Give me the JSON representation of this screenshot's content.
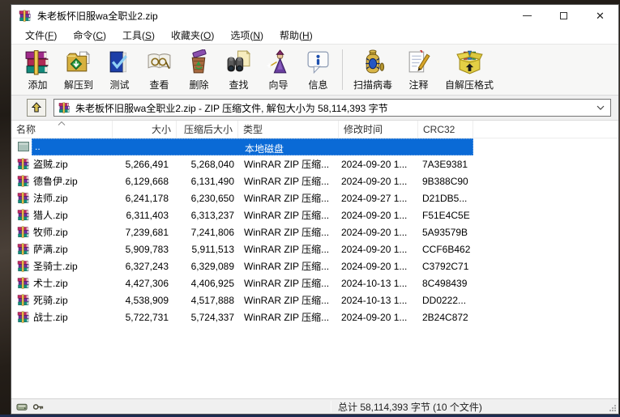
{
  "window": {
    "title": "朱老板怀旧服wa全职业2.zip",
    "controls": {
      "close_glyph": "✕"
    }
  },
  "menu": {
    "items": [
      {
        "pre": "文件(",
        "key": "F",
        "post": ")"
      },
      {
        "pre": "命令(",
        "key": "C",
        "post": ")"
      },
      {
        "pre": "工具(",
        "key": "S",
        "post": ")"
      },
      {
        "pre": "收藏夹(",
        "key": "O",
        "post": ")"
      },
      {
        "pre": "选项(",
        "key": "N",
        "post": ")"
      },
      {
        "pre": "帮助(",
        "key": "H",
        "post": ")"
      }
    ]
  },
  "toolbar": {
    "buttons": [
      {
        "label": "添加",
        "icon": "add-archive-icon"
      },
      {
        "label": "解压到",
        "icon": "extract-to-icon"
      },
      {
        "label": "测试",
        "icon": "test-archive-icon"
      },
      {
        "label": "查看",
        "icon": "view-file-icon"
      },
      {
        "label": "删除",
        "icon": "delete-icon"
      },
      {
        "label": "查找",
        "icon": "find-icon"
      },
      {
        "label": "向导",
        "icon": "wizard-icon"
      },
      {
        "label": "信息",
        "icon": "info-icon"
      },
      {
        "label": "扫描病毒",
        "icon": "scan-virus-icon"
      },
      {
        "label": "注释",
        "icon": "comment-icon"
      },
      {
        "label": "自解压格式",
        "icon": "sfx-icon"
      }
    ]
  },
  "address_bar": {
    "value": "朱老板怀旧服wa全职业2.zip - ZIP 压缩文件, 解包大小为 58,114,393 字节"
  },
  "file_list": {
    "columns": [
      {
        "label": "名称"
      },
      {
        "label": "大小"
      },
      {
        "label": "压缩后大小"
      },
      {
        "label": "类型"
      },
      {
        "label": "修改时间"
      },
      {
        "label": "CRC32"
      }
    ],
    "parent_row": {
      "name": "..",
      "type": "本地磁盘"
    },
    "file_icon": "zip-archive-icon",
    "rows": [
      {
        "name": "盗贼.zip",
        "size": "5,266,491",
        "packed": "5,268,040",
        "type": "WinRAR ZIP 压缩...",
        "modified": "2024-09-20 1...",
        "crc": "7A3E9381"
      },
      {
        "name": "德鲁伊.zip",
        "size": "6,129,668",
        "packed": "6,131,490",
        "type": "WinRAR ZIP 压缩...",
        "modified": "2024-09-20 1...",
        "crc": "9B388C90"
      },
      {
        "name": "法师.zip",
        "size": "6,241,178",
        "packed": "6,230,650",
        "type": "WinRAR ZIP 压缩...",
        "modified": "2024-09-27 1...",
        "crc": "D21DB5..."
      },
      {
        "name": "猎人.zip",
        "size": "6,311,403",
        "packed": "6,313,237",
        "type": "WinRAR ZIP 压缩...",
        "modified": "2024-09-20 1...",
        "crc": "F51E4C5E"
      },
      {
        "name": "牧师.zip",
        "size": "7,239,681",
        "packed": "7,241,806",
        "type": "WinRAR ZIP 压缩...",
        "modified": "2024-09-20 1...",
        "crc": "5A93579B"
      },
      {
        "name": "萨满.zip",
        "size": "5,909,783",
        "packed": "5,911,513",
        "type": "WinRAR ZIP 压缩...",
        "modified": "2024-09-20 1...",
        "crc": "CCF6B462"
      },
      {
        "name": "圣骑士.zip",
        "size": "6,327,243",
        "packed": "6,329,089",
        "type": "WinRAR ZIP 压缩...",
        "modified": "2024-09-20 1...",
        "crc": "C3792C71"
      },
      {
        "name": "术士.zip",
        "size": "4,427,306",
        "packed": "4,406,925",
        "type": "WinRAR ZIP 压缩...",
        "modified": "2024-10-13 1...",
        "crc": "8C498439"
      },
      {
        "name": "死骑.zip",
        "size": "4,538,909",
        "packed": "4,517,888",
        "type": "WinRAR ZIP 压缩...",
        "modified": "2024-10-13 1...",
        "crc": "DD0222..."
      },
      {
        "name": "战士.zip",
        "size": "5,722,731",
        "packed": "5,724,337",
        "type": "WinRAR ZIP 压缩...",
        "modified": "2024-09-20 1...",
        "crc": "2B24C872"
      }
    ]
  },
  "status_bar": {
    "total": "总计 58,114,393 字节 (10 个文件)"
  },
  "colors": {
    "selection_blue": "#0a6ad6",
    "titlebar_bg": "#ffffff",
    "toolbar_bg": "#f7f7f6",
    "statusbar_bg": "#f0f0f0",
    "gold_strap": "#eec94f"
  }
}
